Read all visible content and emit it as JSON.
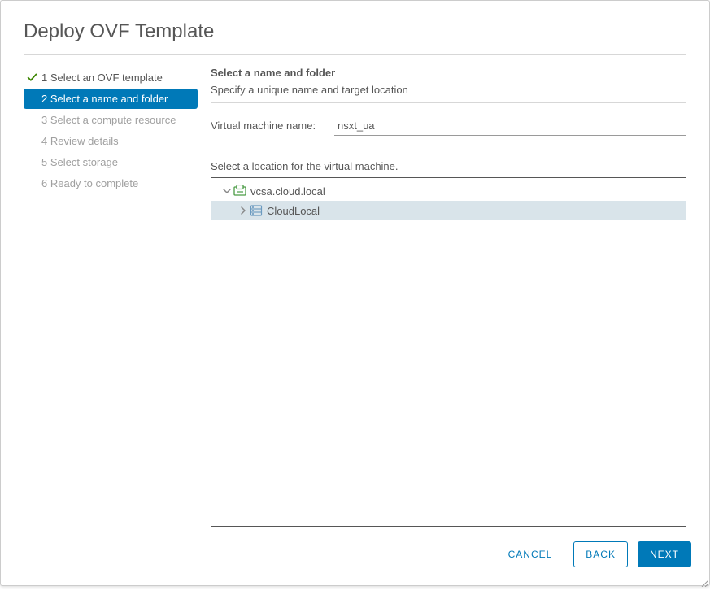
{
  "dialog": {
    "title": "Deploy OVF Template"
  },
  "steps": [
    {
      "label": "1 Select an OVF template",
      "state": "completed"
    },
    {
      "label": "2 Select a name and folder",
      "state": "active"
    },
    {
      "label": "3 Select a compute resource",
      "state": "pending"
    },
    {
      "label": "4 Review details",
      "state": "pending"
    },
    {
      "label": "5 Select storage",
      "state": "pending"
    },
    {
      "label": "6 Ready to complete",
      "state": "pending"
    }
  ],
  "panel": {
    "heading": "Select a name and folder",
    "subheading": "Specify a unique name and target location",
    "vm_name_label": "Virtual machine name:",
    "vm_name_value": "nsxt_ua",
    "location_label": "Select a location for the virtual machine."
  },
  "tree": {
    "root": {
      "label": "vcsa.cloud.local",
      "expanded": true,
      "selected": false
    },
    "child": {
      "label": "CloudLocal",
      "expanded": false,
      "selected": true
    }
  },
  "buttons": {
    "cancel": "CANCEL",
    "back": "BACK",
    "next": "NEXT"
  },
  "colors": {
    "primary": "#0079b8",
    "text": "#565656",
    "muted": "#a0a0a0",
    "selected_bg": "#d9e4ea",
    "success": "#3c8500"
  }
}
